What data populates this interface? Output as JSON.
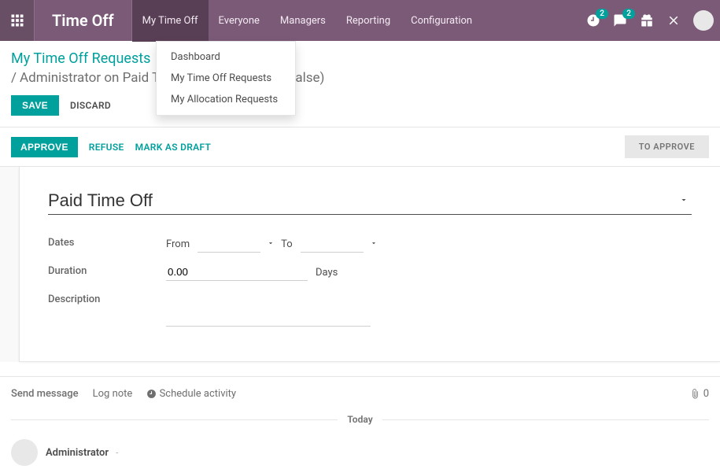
{
  "header": {
    "module": "Time Off",
    "nav": [
      "My Time Off",
      "Everyone",
      "Managers",
      "Reporting",
      "Configuration"
    ],
    "active_nav_index": 0,
    "activity_badge": "2",
    "discuss_badge": "2"
  },
  "dropdown": {
    "items": [
      "Dashboard",
      "My Time Off Requests",
      "My Allocation Requests"
    ]
  },
  "breadcrumb": {
    "top": "My Time Off Requests",
    "current": "Administrator on Paid Time Off : 0.00 day(s) (False)"
  },
  "buttons": {
    "save": "SAVE",
    "discard": "DISCARD",
    "approve": "APPROVE",
    "refuse": "REFUSE",
    "draft": "MARK AS DRAFT"
  },
  "status": {
    "stage": "TO APPROVE"
  },
  "form": {
    "type_value": "Paid Time Off",
    "labels": {
      "dates": "Dates",
      "duration": "Duration",
      "description": "Description",
      "from": "From",
      "to": "To",
      "days": "Days"
    },
    "duration_value": "0.00"
  },
  "chatter": {
    "send": "Send message",
    "log": "Log note",
    "schedule": "Schedule activity",
    "attach_count": "0",
    "divider": "Today",
    "author": "Administrator",
    "meta": "-"
  }
}
